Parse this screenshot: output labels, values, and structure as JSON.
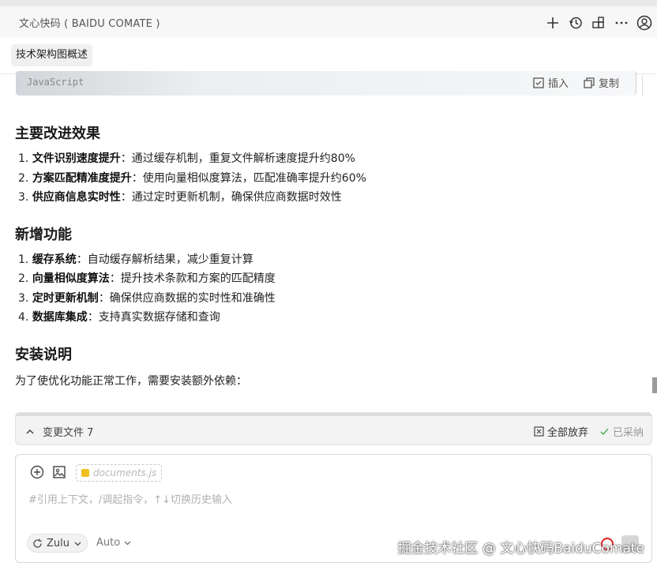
{
  "app": {
    "title": "文心快码 ( BAIDU COMATE )"
  },
  "toolbar_icons": [
    "plus-icon",
    "history-icon",
    "grid-icon",
    "more-icon",
    "account-icon"
  ],
  "tab": {
    "label": "技术架构图概述"
  },
  "code_block": {
    "language": "JavaScript",
    "insert_label": "插入",
    "copy_label": "复制"
  },
  "sections": [
    {
      "heading": "主要改进效果",
      "items": [
        {
          "bold": "文件识别速度提升",
          "text": "：通过缓存机制，重复文件解析速度提升约80%"
        },
        {
          "bold": "方案匹配精准度提升",
          "text": "：使用向量相似度算法，匹配准确率提升约60%"
        },
        {
          "bold": "供应商信息实时性",
          "text": "：通过定时更新机制，确保供应商数据时效性"
        }
      ]
    },
    {
      "heading": "新增功能",
      "items": [
        {
          "bold": "缓存系统",
          "text": "：自动缓存解析结果，减少重复计算"
        },
        {
          "bold": "向量相似度算法",
          "text": "：提升技术条款和方案的匹配精度"
        },
        {
          "bold": "定时更新机制",
          "text": "：确保供应商数据的实时性和准确性"
        },
        {
          "bold": "数据库集成",
          "text": "：支持真实数据存储和查询"
        }
      ]
    },
    {
      "heading": "安装说明",
      "paragraph": "为了使优化功能正常工作，需要安装额外依赖："
    }
  ],
  "changes_bar": {
    "label": "变更文件 7",
    "discard_all": "全部放弃",
    "accepted": "已采纳"
  },
  "composer": {
    "file_chip": "documents.js",
    "placeholder": "#引用上下文，/调起指令，↑↓切换历史输入",
    "model": "Zulu",
    "mode": "Auto"
  },
  "watermark": "掘金技术社区 @ 文心快码BaiduComate",
  "colors": {
    "accent_red": "#e02020",
    "js_badge": "#f0c020",
    "accepted_check": "#4caf50"
  }
}
